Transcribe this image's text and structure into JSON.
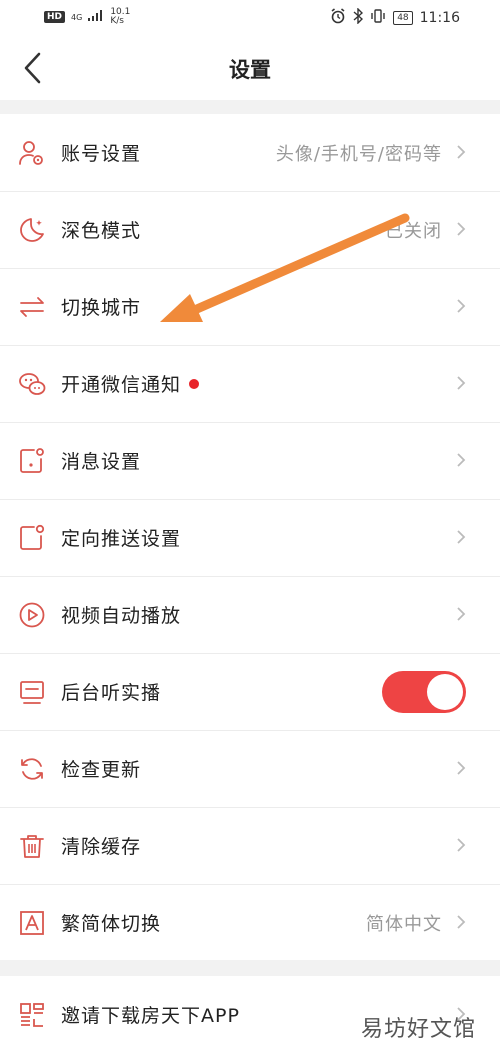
{
  "status_bar": {
    "hd": "HD",
    "network": "4G",
    "speed_value": "10.1",
    "speed_unit": "K/s",
    "battery": "48",
    "time": "11:16"
  },
  "nav": {
    "title": "设置"
  },
  "settings": [
    {
      "label": "账号设置",
      "value": "头像/手机号/密码等",
      "icon": "account-gear-icon"
    },
    {
      "label": "深色模式",
      "value": "已关闭",
      "icon": "moon-icon"
    },
    {
      "label": "切换城市",
      "value": "",
      "icon": "swap-arrows-icon"
    },
    {
      "label": "开通微信通知",
      "value": "",
      "icon": "wechat-icon"
    },
    {
      "label": "消息设置",
      "value": "",
      "icon": "message-settings-icon"
    },
    {
      "label": "定向推送设置",
      "value": "",
      "icon": "targeted-push-icon"
    },
    {
      "label": "视频自动播放",
      "value": "",
      "icon": "play-circle-icon"
    },
    {
      "label": "后台听实播",
      "value": "",
      "icon": "monitor-icon",
      "toggle_on": true
    },
    {
      "label": "检查更新",
      "value": "",
      "icon": "refresh-icon"
    },
    {
      "label": "清除缓存",
      "value": "",
      "icon": "trash-icon"
    },
    {
      "label": "繁简体切换",
      "value": "简体中文",
      "icon": "font-a-icon"
    }
  ],
  "invite": {
    "label": "邀请下载房天下APP",
    "icon": "qr-code-icon"
  },
  "watermark": "易坊好文馆",
  "colors": {
    "accent": "#e8242a",
    "toggle": "#ee4444",
    "arrow": "#f08a3a",
    "icon": "#d9574f"
  }
}
